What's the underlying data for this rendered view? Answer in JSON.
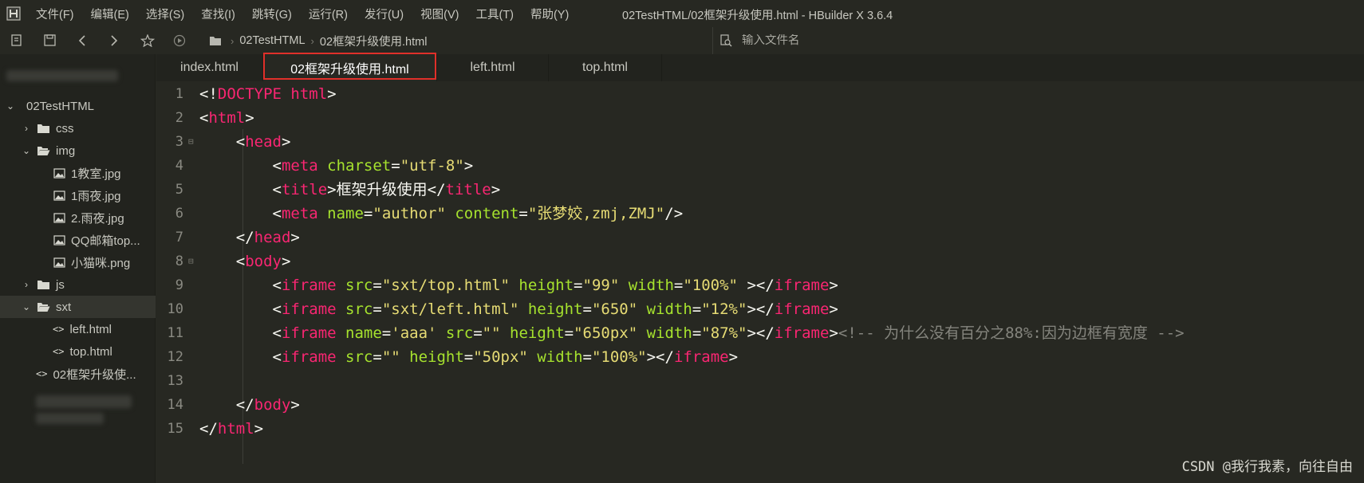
{
  "menu": {
    "items": [
      "文件(F)",
      "编辑(E)",
      "选择(S)",
      "查找(I)",
      "跳转(G)",
      "运行(R)",
      "发行(U)",
      "视图(V)",
      "工具(T)",
      "帮助(Y)"
    ]
  },
  "window_title": "02TestHTML/02框架升级使用.html - HBuilder X 3.6.4",
  "toolbar": {
    "icons": [
      "new-file-icon",
      "save-icon",
      "back-icon",
      "forward-icon",
      "star-icon",
      "run-icon"
    ]
  },
  "breadcrumb": {
    "items": [
      "02TestHTML",
      "02框架升级使用.html"
    ]
  },
  "file_search": {
    "placeholder": "输入文件名"
  },
  "sidebar": {
    "project": "02TestHTML",
    "tree": [
      {
        "label": "css",
        "type": "folder",
        "depth": 1,
        "expanded": false
      },
      {
        "label": "img",
        "type": "folder",
        "depth": 1,
        "expanded": true
      },
      {
        "label": "1教室.jpg",
        "type": "image",
        "depth": 2
      },
      {
        "label": "1雨夜.jpg",
        "type": "image",
        "depth": 2
      },
      {
        "label": "2.雨夜.jpg",
        "type": "image",
        "depth": 2
      },
      {
        "label": "QQ邮箱top...",
        "type": "image",
        "depth": 2
      },
      {
        "label": "小猫咪.png",
        "type": "image",
        "depth": 2
      },
      {
        "label": "js",
        "type": "folder",
        "depth": 1,
        "expanded": false
      },
      {
        "label": "sxt",
        "type": "folder",
        "depth": 1,
        "expanded": true,
        "selected": true
      },
      {
        "label": "left.html",
        "type": "html",
        "depth": 2
      },
      {
        "label": "top.html",
        "type": "html",
        "depth": 2
      },
      {
        "label": "02框架升级使...",
        "type": "html",
        "depth": 1
      }
    ]
  },
  "tabs": [
    {
      "label": "index.html",
      "active": false
    },
    {
      "label": "02框架升级使用.html",
      "active": true
    },
    {
      "label": "left.html",
      "active": false
    },
    {
      "label": "top.html",
      "active": false
    }
  ],
  "editor": {
    "line_numbers": [
      "1",
      "2",
      "3",
      "4",
      "5",
      "6",
      "7",
      "8",
      "9",
      "10",
      "11",
      "12",
      "13",
      "14",
      "15"
    ],
    "lines": [
      [
        [
          "p",
          "<!"
        ],
        [
          "doc",
          "DOCTYPE html"
        ],
        [
          "p",
          ">"
        ]
      ],
      [
        [
          "p",
          "<"
        ],
        [
          "t",
          "html"
        ],
        [
          "p",
          ">"
        ]
      ],
      [
        [
          "p",
          "    <"
        ],
        [
          "t",
          "head"
        ],
        [
          "p",
          ">"
        ]
      ],
      [
        [
          "p",
          "        <"
        ],
        [
          "t",
          "meta "
        ],
        [
          "a",
          "charset"
        ],
        [
          "p",
          "="
        ],
        [
          "s",
          "\"utf-8\""
        ],
        [
          "p",
          ">"
        ]
      ],
      [
        [
          "p",
          "        <"
        ],
        [
          "t",
          "title"
        ],
        [
          "p",
          ">"
        ],
        [
          "txt",
          "框架升级使用"
        ],
        [
          "p",
          "</"
        ],
        [
          "t",
          "title"
        ],
        [
          "p",
          ">"
        ]
      ],
      [
        [
          "p",
          "        <"
        ],
        [
          "t",
          "meta "
        ],
        [
          "a",
          "name"
        ],
        [
          "p",
          "="
        ],
        [
          "s",
          "\"author\""
        ],
        [
          "a",
          " content"
        ],
        [
          "p",
          "="
        ],
        [
          "s",
          "\"张梦姣,zmj,ZMJ\""
        ],
        [
          "p",
          "/>"
        ]
      ],
      [
        [
          "p",
          "    </"
        ],
        [
          "t",
          "head"
        ],
        [
          "p",
          ">"
        ]
      ],
      [
        [
          "p",
          "    <"
        ],
        [
          "t",
          "body"
        ],
        [
          "p",
          ">"
        ]
      ],
      [
        [
          "p",
          "        <"
        ],
        [
          "t",
          "iframe "
        ],
        [
          "a",
          "src"
        ],
        [
          "p",
          "="
        ],
        [
          "s",
          "\"sxt/top.html\""
        ],
        [
          "a",
          " height"
        ],
        [
          "p",
          "="
        ],
        [
          "s",
          "\"99\""
        ],
        [
          "a",
          " width"
        ],
        [
          "p",
          "="
        ],
        [
          "s",
          "\"100%\""
        ],
        [
          "p",
          " ></"
        ],
        [
          "t",
          "iframe"
        ],
        [
          "p",
          ">"
        ]
      ],
      [
        [
          "p",
          "        <"
        ],
        [
          "t",
          "iframe "
        ],
        [
          "a",
          "src"
        ],
        [
          "p",
          "="
        ],
        [
          "s",
          "\"sxt/left.html\""
        ],
        [
          "a",
          " height"
        ],
        [
          "p",
          "="
        ],
        [
          "s",
          "\"650\""
        ],
        [
          "a",
          " width"
        ],
        [
          "p",
          "="
        ],
        [
          "s",
          "\"12%\""
        ],
        [
          "p",
          "></"
        ],
        [
          "t",
          "iframe"
        ],
        [
          "p",
          ">"
        ]
      ],
      [
        [
          "p",
          "        <"
        ],
        [
          "t",
          "iframe "
        ],
        [
          "a",
          "name"
        ],
        [
          "p",
          "="
        ],
        [
          "s",
          "'aaa'"
        ],
        [
          "a",
          " src"
        ],
        [
          "p",
          "="
        ],
        [
          "s",
          "\"\""
        ],
        [
          "a",
          " height"
        ],
        [
          "p",
          "="
        ],
        [
          "s",
          "\"650px\""
        ],
        [
          "a",
          " width"
        ],
        [
          "p",
          "="
        ],
        [
          "s",
          "\"87%\""
        ],
        [
          "p",
          "></"
        ],
        [
          "t",
          "iframe"
        ],
        [
          "p",
          ">"
        ],
        [
          "cm",
          "<!-- 为什么没有百分之88%:因为边框有宽度 -->"
        ]
      ],
      [
        [
          "p",
          "        <"
        ],
        [
          "t",
          "iframe "
        ],
        [
          "a",
          "src"
        ],
        [
          "p",
          "="
        ],
        [
          "s",
          "\"\""
        ],
        [
          "a",
          " height"
        ],
        [
          "p",
          "="
        ],
        [
          "s",
          "\"50px\""
        ],
        [
          "a",
          " width"
        ],
        [
          "p",
          "="
        ],
        [
          "s",
          "\"100%\""
        ],
        [
          "p",
          "></"
        ],
        [
          "t",
          "iframe"
        ],
        [
          "p",
          ">"
        ]
      ],
      [],
      [
        [
          "p",
          "    </"
        ],
        [
          "t",
          "body"
        ],
        [
          "p",
          ">"
        ]
      ],
      [
        [
          "p",
          "</"
        ],
        [
          "t",
          "html"
        ],
        [
          "p",
          ">"
        ]
      ]
    ],
    "fold_markers": [
      "3",
      "8"
    ]
  },
  "watermark": "CSDN @我行我素，向往自由",
  "colors": {
    "background": "#272822",
    "sidebar": "#22231e",
    "tag": "#f92672",
    "attribute": "#a6e22e",
    "string": "#e6db74",
    "comment": "#85857e",
    "highlight_box": "#e0302a"
  }
}
